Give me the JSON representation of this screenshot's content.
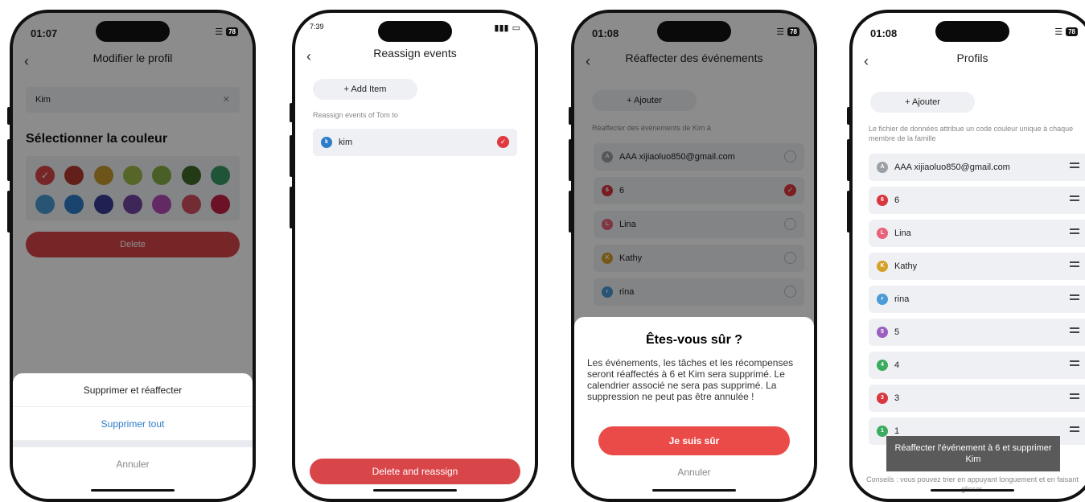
{
  "phone1": {
    "time": "01:07",
    "battery": "78",
    "title": "Modifier le profil",
    "name_value": "Kim",
    "section_title": "Sélectionner la couleur",
    "colors": [
      "#d9464a",
      "#b43a2e",
      "#c79a2f",
      "#9db84a",
      "#87ad44",
      "#3e6a29",
      "#3b9a67",
      "#4b9bd6",
      "#2d7cc8",
      "#3a3c95",
      "#7446a3",
      "#b54cb9",
      "#d24f5f",
      "#c42248"
    ],
    "delete_label": "Delete",
    "sheet": {
      "primary": "Supprimer et réaffecter",
      "secondary": "Supprimer tout",
      "cancel": "Annuler"
    }
  },
  "phone2": {
    "time": "7:39",
    "title": "Reassign events",
    "add_item": "+ Add Item",
    "hint": "Reassign events of Tom to",
    "profile": {
      "initial": "k",
      "name": "kim",
      "color": "#2d7cc8"
    },
    "button": "Delete and reassign"
  },
  "phone3": {
    "time": "01:08",
    "battery": "78",
    "title": "Réaffecter des événements",
    "add": "+ Ajouter",
    "hint": "Réaffecter des événements de Kim à",
    "profiles": [
      {
        "initial": "A",
        "name": "AAA xijiaoluo850@gmail.com",
        "color": "#9aa0a6",
        "selected": false
      },
      {
        "initial": "6",
        "name": "6",
        "color": "#d9363e",
        "selected": true
      },
      {
        "initial": "L",
        "name": "Lina",
        "color": "#e8637a",
        "selected": false
      },
      {
        "initial": "K",
        "name": "Kathy",
        "color": "#d6a12a",
        "selected": false
      },
      {
        "initial": "r",
        "name": "rina",
        "color": "#4b9bd6",
        "selected": false
      }
    ],
    "dialog": {
      "title": "Êtes-vous sûr ?",
      "body": "Les événements, les tâches et les récompenses seront réaffectés à 6 et Kim sera supprimé. Le calendrier associé ne sera pas supprimé. La suppression ne peut pas être annulée !",
      "confirm": "Je suis sûr",
      "cancel": "Annuler"
    }
  },
  "phone4": {
    "time": "01:08",
    "battery": "78",
    "title": "Profils",
    "add": "+ Ajouter",
    "hint": "Le fichier de données attribue un code couleur unique à chaque membre de la famille",
    "profiles": [
      {
        "initial": "A",
        "name": "AAA xijiaoluo850@gmail.com",
        "color": "#9aa0a6"
      },
      {
        "initial": "6",
        "name": "6",
        "color": "#d9363e"
      },
      {
        "initial": "L",
        "name": "Lina",
        "color": "#e8637a"
      },
      {
        "initial": "K",
        "name": "Kathy",
        "color": "#d6a12a"
      },
      {
        "initial": "r",
        "name": "rina",
        "color": "#4b9bd6"
      },
      {
        "initial": "5",
        "name": "5",
        "color": "#9b5fc0"
      },
      {
        "initial": "4",
        "name": "4",
        "color": "#3bab5e"
      },
      {
        "initial": "3",
        "name": "3",
        "color": "#d9363e"
      },
      {
        "initial": "1",
        "name": "1",
        "color": "#3bab5e"
      }
    ],
    "toast": "Réaffecter l'événement à 6 et supprimer Kim",
    "tip": "Conseils : vous pouvez trier en appuyant longuement et en faisant glisser."
  }
}
